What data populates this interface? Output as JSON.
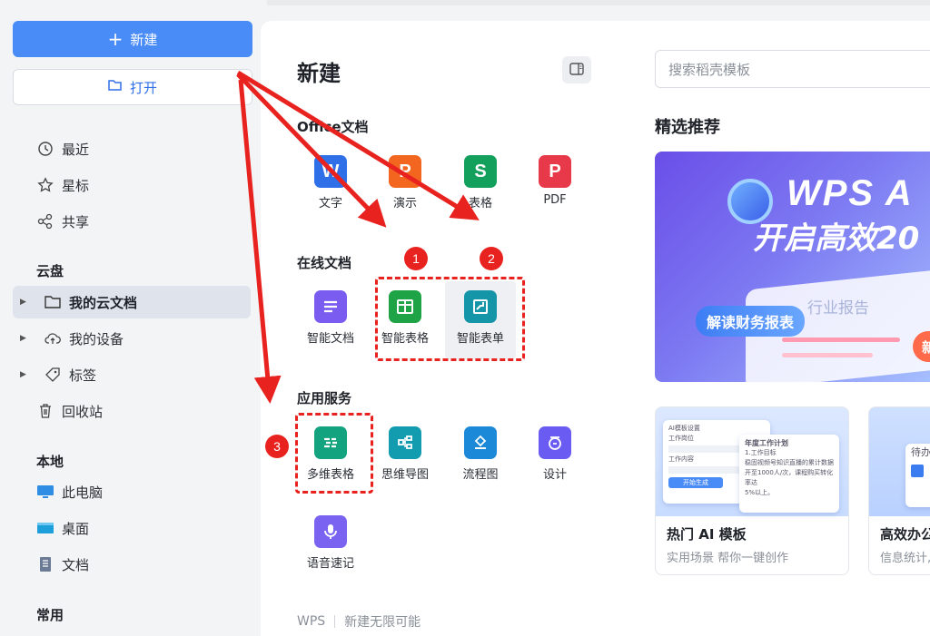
{
  "sidebar": {
    "new_label": "新建",
    "open_label": "打开",
    "recent": "最近",
    "starred": "星标",
    "shared": "共享",
    "cloud_section": "云盘",
    "my_cloud_docs": "我的云文档",
    "my_devices": "我的设备",
    "tags": "标签",
    "trash": "回收站",
    "local_section": "本地",
    "this_pc": "此电脑",
    "desktop": "桌面",
    "documents": "文档",
    "common_section": "常用"
  },
  "main": {
    "title": "新建",
    "office_section": "Office文档",
    "office_apps": [
      "文字",
      "演示",
      "表格",
      "PDF"
    ],
    "online_section": "在线文档",
    "online_apps": [
      "智能文档",
      "智能表格",
      "智能表单"
    ],
    "services_section": "应用服务",
    "service_apps": [
      "多维表格",
      "思维导图",
      "流程图",
      "设计",
      "语音速记"
    ],
    "footer_brand": "WPS",
    "footer_slogan": "新建无限可能"
  },
  "annotations": {
    "badges": [
      "1",
      "2",
      "3"
    ]
  },
  "right": {
    "search_placeholder": "搜索稻壳模板",
    "recommend_title": "精选推荐",
    "banner": {
      "headline": "WPS A",
      "subline": "开启高效20",
      "pill": "解读财务报表",
      "doc_label": "行业报告",
      "pill2": "新"
    },
    "cards": [
      {
        "title": "热门 AI 模板",
        "subtitle": "实用场景 帮你一键创作",
        "mock_header": "AI模板设置",
        "mock_field1": "工作岗位",
        "mock_field2": "工作内容",
        "mock_button": "开始生成",
        "mock_doc_title": "年度工作计划",
        "mock_doc_line1": "1.工作目标",
        "mock_doc_line2": "稳固视频号知识直播的累计数据",
        "mock_doc_line3": "开至1000人/次，课程购买转化率达",
        "mock_doc_line4": "5%以上。"
      },
      {
        "title": "高效办公",
        "subtitle": "信息统计,",
        "mock_label": "待办"
      }
    ]
  },
  "colors": {
    "accent": "#4a8cf7",
    "annotation": "#e8231f",
    "writer": "#2f6fe8",
    "presentation": "#f2661f",
    "spreadsheet": "#12a05c",
    "pdf": "#e8394a",
    "smart_doc": "#7b5cf0",
    "smart_sheet": "#1fa347",
    "smart_form": "#1496a8",
    "multi_table": "#13a37e",
    "mindmap": "#139bb0",
    "flowchart": "#1b88d8",
    "design": "#6a5cf2",
    "voice": "#7a63f0"
  }
}
